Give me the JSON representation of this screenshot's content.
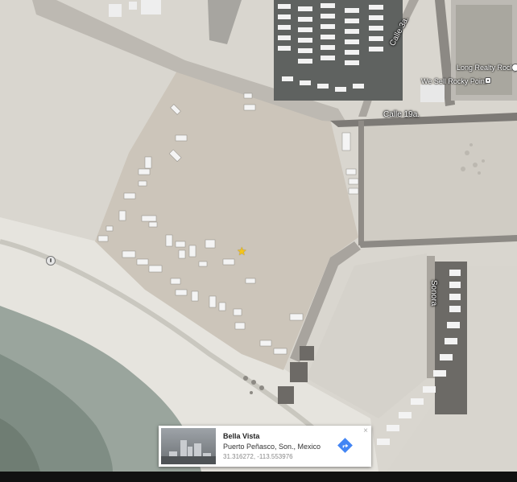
{
  "map": {
    "roads": {
      "calle_3a": "Calle 3a.",
      "calle_19a": "Calle 19a.",
      "sonora": "Sonora"
    },
    "pois": {
      "long_realty": "Long Realty Rocky F",
      "we_sell": "We Sell Rocky Point"
    },
    "icons": {
      "selected_marker": "star-icon",
      "street_view": "pegman-icon",
      "poi": "business-icon",
      "directions": "directions-icon",
      "close": "close-icon"
    },
    "colors": {
      "star": "#f5c518",
      "directions": "#4285f4"
    }
  },
  "info_card": {
    "title": "Bella Vista",
    "address": "Puerto Peñasco, Son., Mexico",
    "coordinates": "31.316272, -113.553976",
    "close_glyph": "×"
  }
}
